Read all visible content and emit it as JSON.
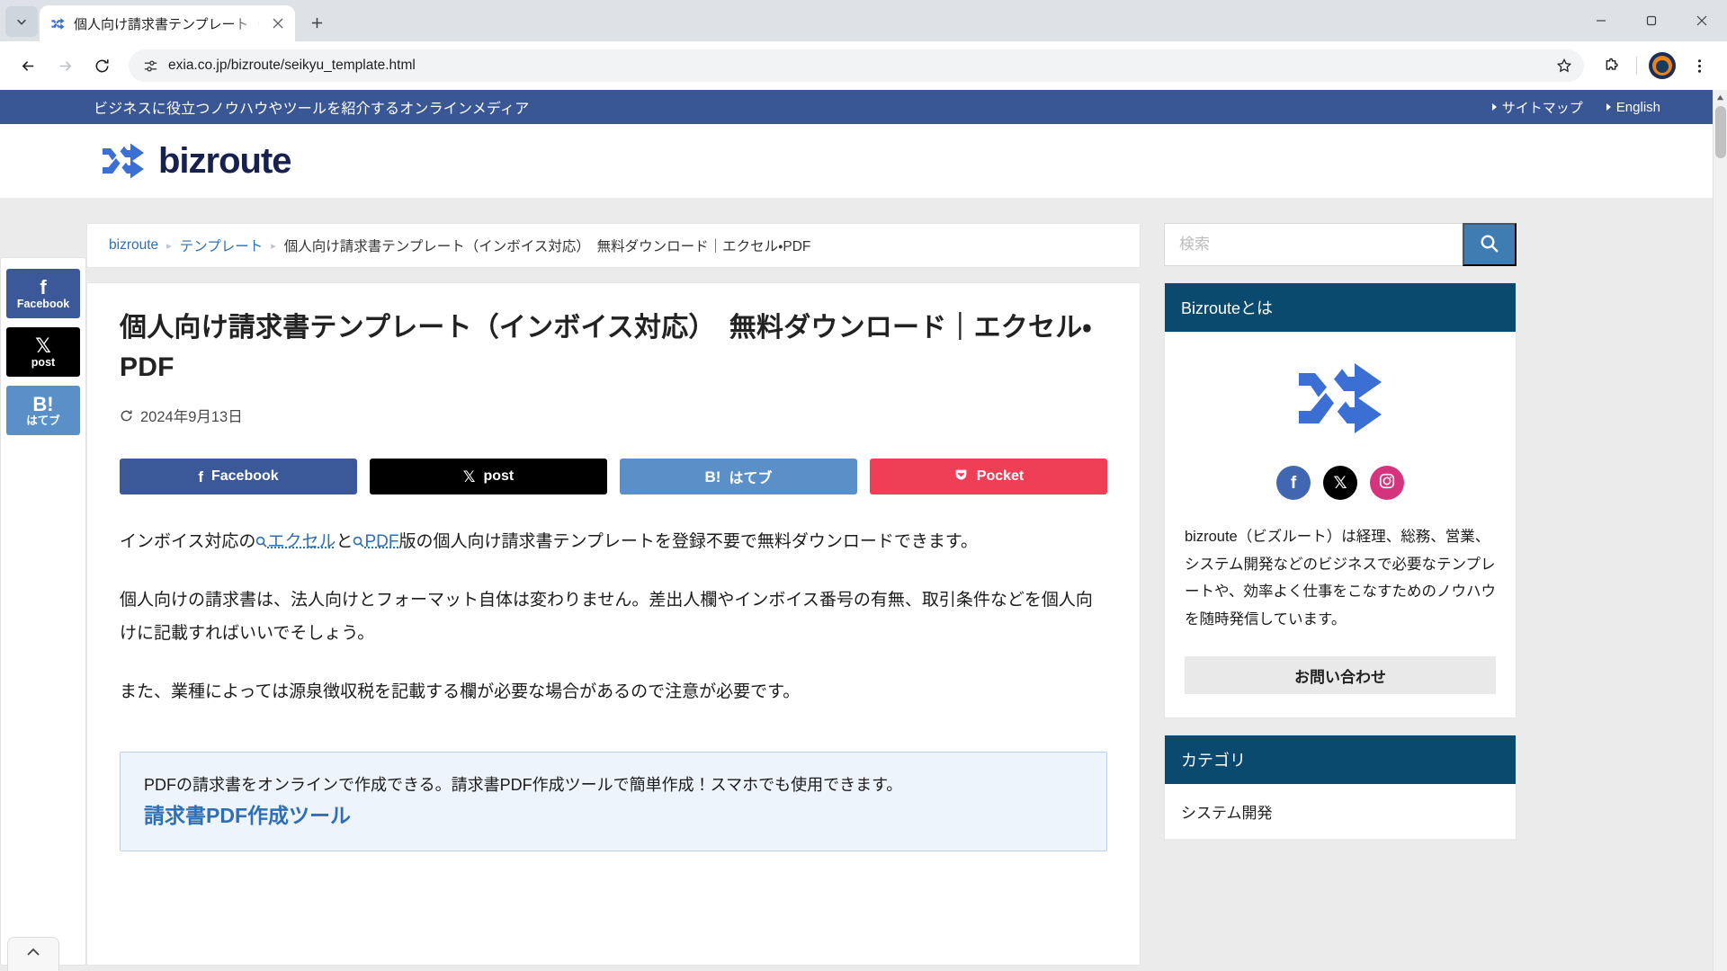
{
  "browser": {
    "tab": {
      "title": "個人向け請求書テンプレート（インボ",
      "favicon_icon": "shuffle-icon",
      "close_icon": "close-icon"
    },
    "tab_search_icon": "chevron-down-icon",
    "new_tab_icon": "plus-icon",
    "window": {
      "minimize_icon": "minimize-icon",
      "maximize_icon": "maximize-icon",
      "close_icon": "close-icon"
    },
    "toolbar": {
      "back_icon": "arrow-left-icon",
      "forward_icon": "arrow-right-icon",
      "reload_icon": "reload-icon",
      "site_info_icon": "tune-icon",
      "url": "exia.co.jp/bizroute/seikyu_template.html",
      "bookmark_icon": "star-icon",
      "extensions_icon": "puzzle-icon",
      "profile_icon": "avatar-icon",
      "menu_icon": "more-vertical-icon"
    }
  },
  "site": {
    "tagline": "ビジネスに役立つノウハウやツールを紹介するオンラインメディア",
    "topbar_links": [
      {
        "label": "サイトマップ"
      },
      {
        "label": "English"
      }
    ],
    "logo": {
      "text": "bizroute",
      "mark_icon": "shuffle-icon"
    }
  },
  "breadcrumb": {
    "items": [
      {
        "label": "bizroute",
        "link": true
      },
      {
        "label": "テンプレート",
        "link": true
      },
      {
        "label": "個人向け請求書テンプレート（インボイス対応）　無料ダウンロード｜エクセル・PDF",
        "link": false
      }
    ],
    "separator": "▸"
  },
  "share_rail": [
    {
      "name": "facebook",
      "glyph": "f",
      "label": "Facebook",
      "color": "#3b5998"
    },
    {
      "name": "x-twitter",
      "glyph": "𝕏",
      "label": "post",
      "color": "#000000"
    },
    {
      "name": "hatena",
      "glyph": "B!",
      "label": "はてブ",
      "color": "#5b8fc7"
    }
  ],
  "article": {
    "title": "個人向け請求書テンプレート（インボイス対応）　無料ダウンロード｜エクセル・PDF",
    "date": "2024年9月13日",
    "date_icon": "refresh-icon",
    "share_buttons": [
      {
        "name": "facebook",
        "glyph": "f",
        "label": "Facebook",
        "color": "#3b5998"
      },
      {
        "name": "x-twitter",
        "glyph": "𝕏",
        "label": "post",
        "color": "#000000"
      },
      {
        "name": "hatena",
        "glyph": "B!",
        "label": "はてブ",
        "color": "#5b8fc7"
      },
      {
        "name": "pocket",
        "glyph": "▼",
        "label": "Pocket",
        "color": "#ef3f56"
      }
    ],
    "paragraph1": {
      "lead": "インボイス対応の",
      "link1": "エクセル",
      "middle": "と",
      "link2": "PDF",
      "tail": "版の個人向け請求書テンプレートを登録不要で無料ダウンロードできます。"
    },
    "paragraph2": "個人向けの請求書は、法人向けとフォーマット自体は変わりません。差出人欄やインボイス番号の有無、取引条件などを個人向けに記載すればいいでそしょう。",
    "paragraph3": "また、業種によっては源泉徴収税を記載する欄が必要な場合があるので注意が必要です。",
    "callout": {
      "text": "PDFの請求書をオンラインで作成できる。請求書PDF作成ツールで簡単作成！スマホでも使用できます。",
      "link": "請求書PDF作成ツール"
    }
  },
  "sidebar": {
    "search": {
      "placeholder": "検索",
      "value": "",
      "button_icon": "search-icon"
    },
    "about": {
      "heading": "Bizrouteとは",
      "logo_icon": "shuffle-icon",
      "socials": [
        {
          "name": "facebook",
          "glyph": "f",
          "color": "#4267b2"
        },
        {
          "name": "x-twitter",
          "glyph": "𝕏",
          "color": "#000000"
        },
        {
          "name": "instagram",
          "glyph": "◎",
          "color": "#d6337f"
        }
      ],
      "text": "bizroute（ビズルート）は経理、総務、営業、システム開発などのビジネスで必要なテンプレートや、効率よく仕事をこなすためのノウハウを随時発信しています。",
      "contact_label": "お問い合わせ"
    },
    "category": {
      "heading": "カテゴリ",
      "items": [
        {
          "label": "システム開発"
        }
      ]
    }
  },
  "scroll_to_top": {
    "icon": "chevron-up-icon"
  },
  "colors": {
    "topbar": "#3a5795",
    "brand_navy": "#16214e",
    "widget_head": "#0a4a6e",
    "link": "#2f6fb5",
    "search_button": "#3e7cb1"
  }
}
